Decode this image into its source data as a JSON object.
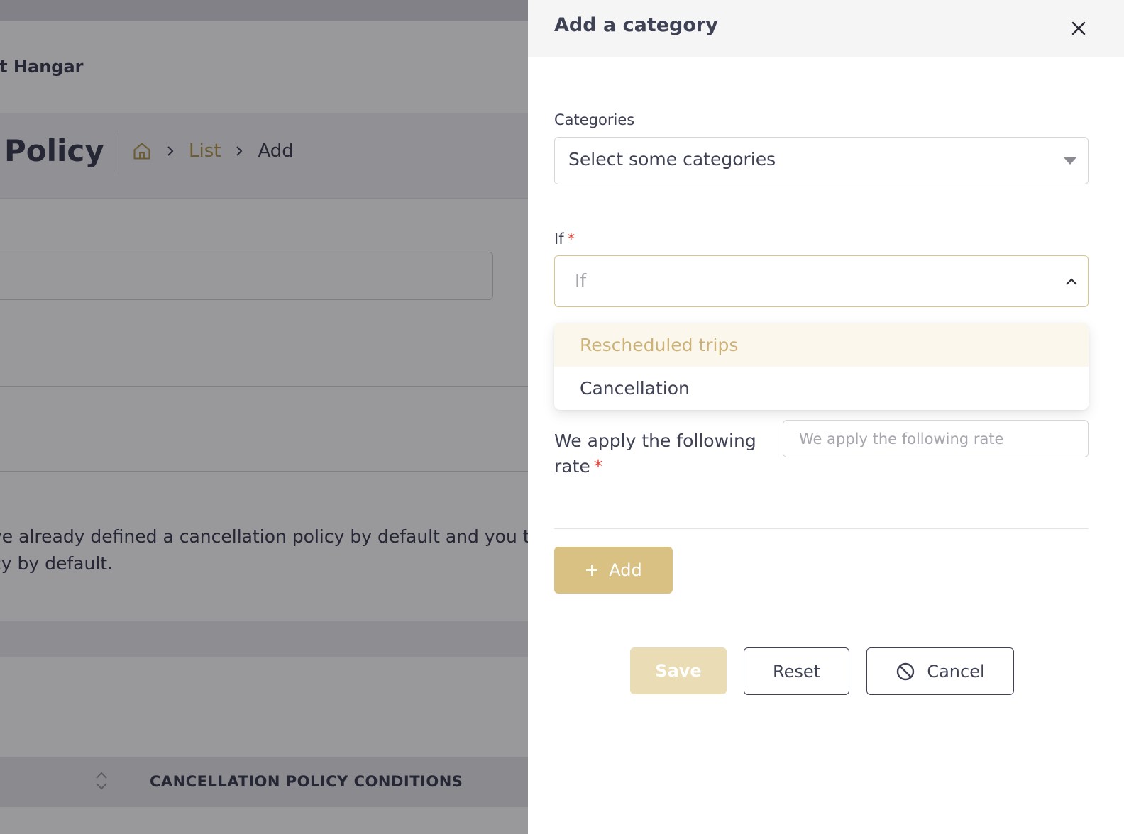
{
  "background": {
    "brand": "nt Hangar",
    "page_title": "Policy",
    "breadcrumb": {
      "home_icon": "home-icon",
      "link": "List",
      "current": "Add"
    },
    "paragraph_line1": "ve already defined a cancellation policy by default and you t",
    "paragraph_line2": "cy by default.",
    "table_column_header": "CANCELLATION POLICY CONDITIONS"
  },
  "drawer": {
    "title": "Add a category",
    "close_icon": "close-icon",
    "categories": {
      "label": "Categories",
      "placeholder": "Select some categories"
    },
    "if_field": {
      "label": "If",
      "required_mark": "*",
      "placeholder": "If",
      "options": [
        {
          "label": "Rescheduled trips",
          "highlighted": true
        },
        {
          "label": "Cancellation",
          "highlighted": false
        }
      ]
    },
    "rate": {
      "label": "We apply the following rate",
      "required_mark": "*",
      "placeholder": "We apply the following rate"
    },
    "buttons": {
      "add": "Add",
      "save": "Save",
      "reset": "Reset",
      "cancel": "Cancel"
    }
  },
  "colors": {
    "accent": "#d9c184",
    "accent_text": "#b49a4f",
    "text": "#3f4254",
    "required": "#e0453a"
  }
}
